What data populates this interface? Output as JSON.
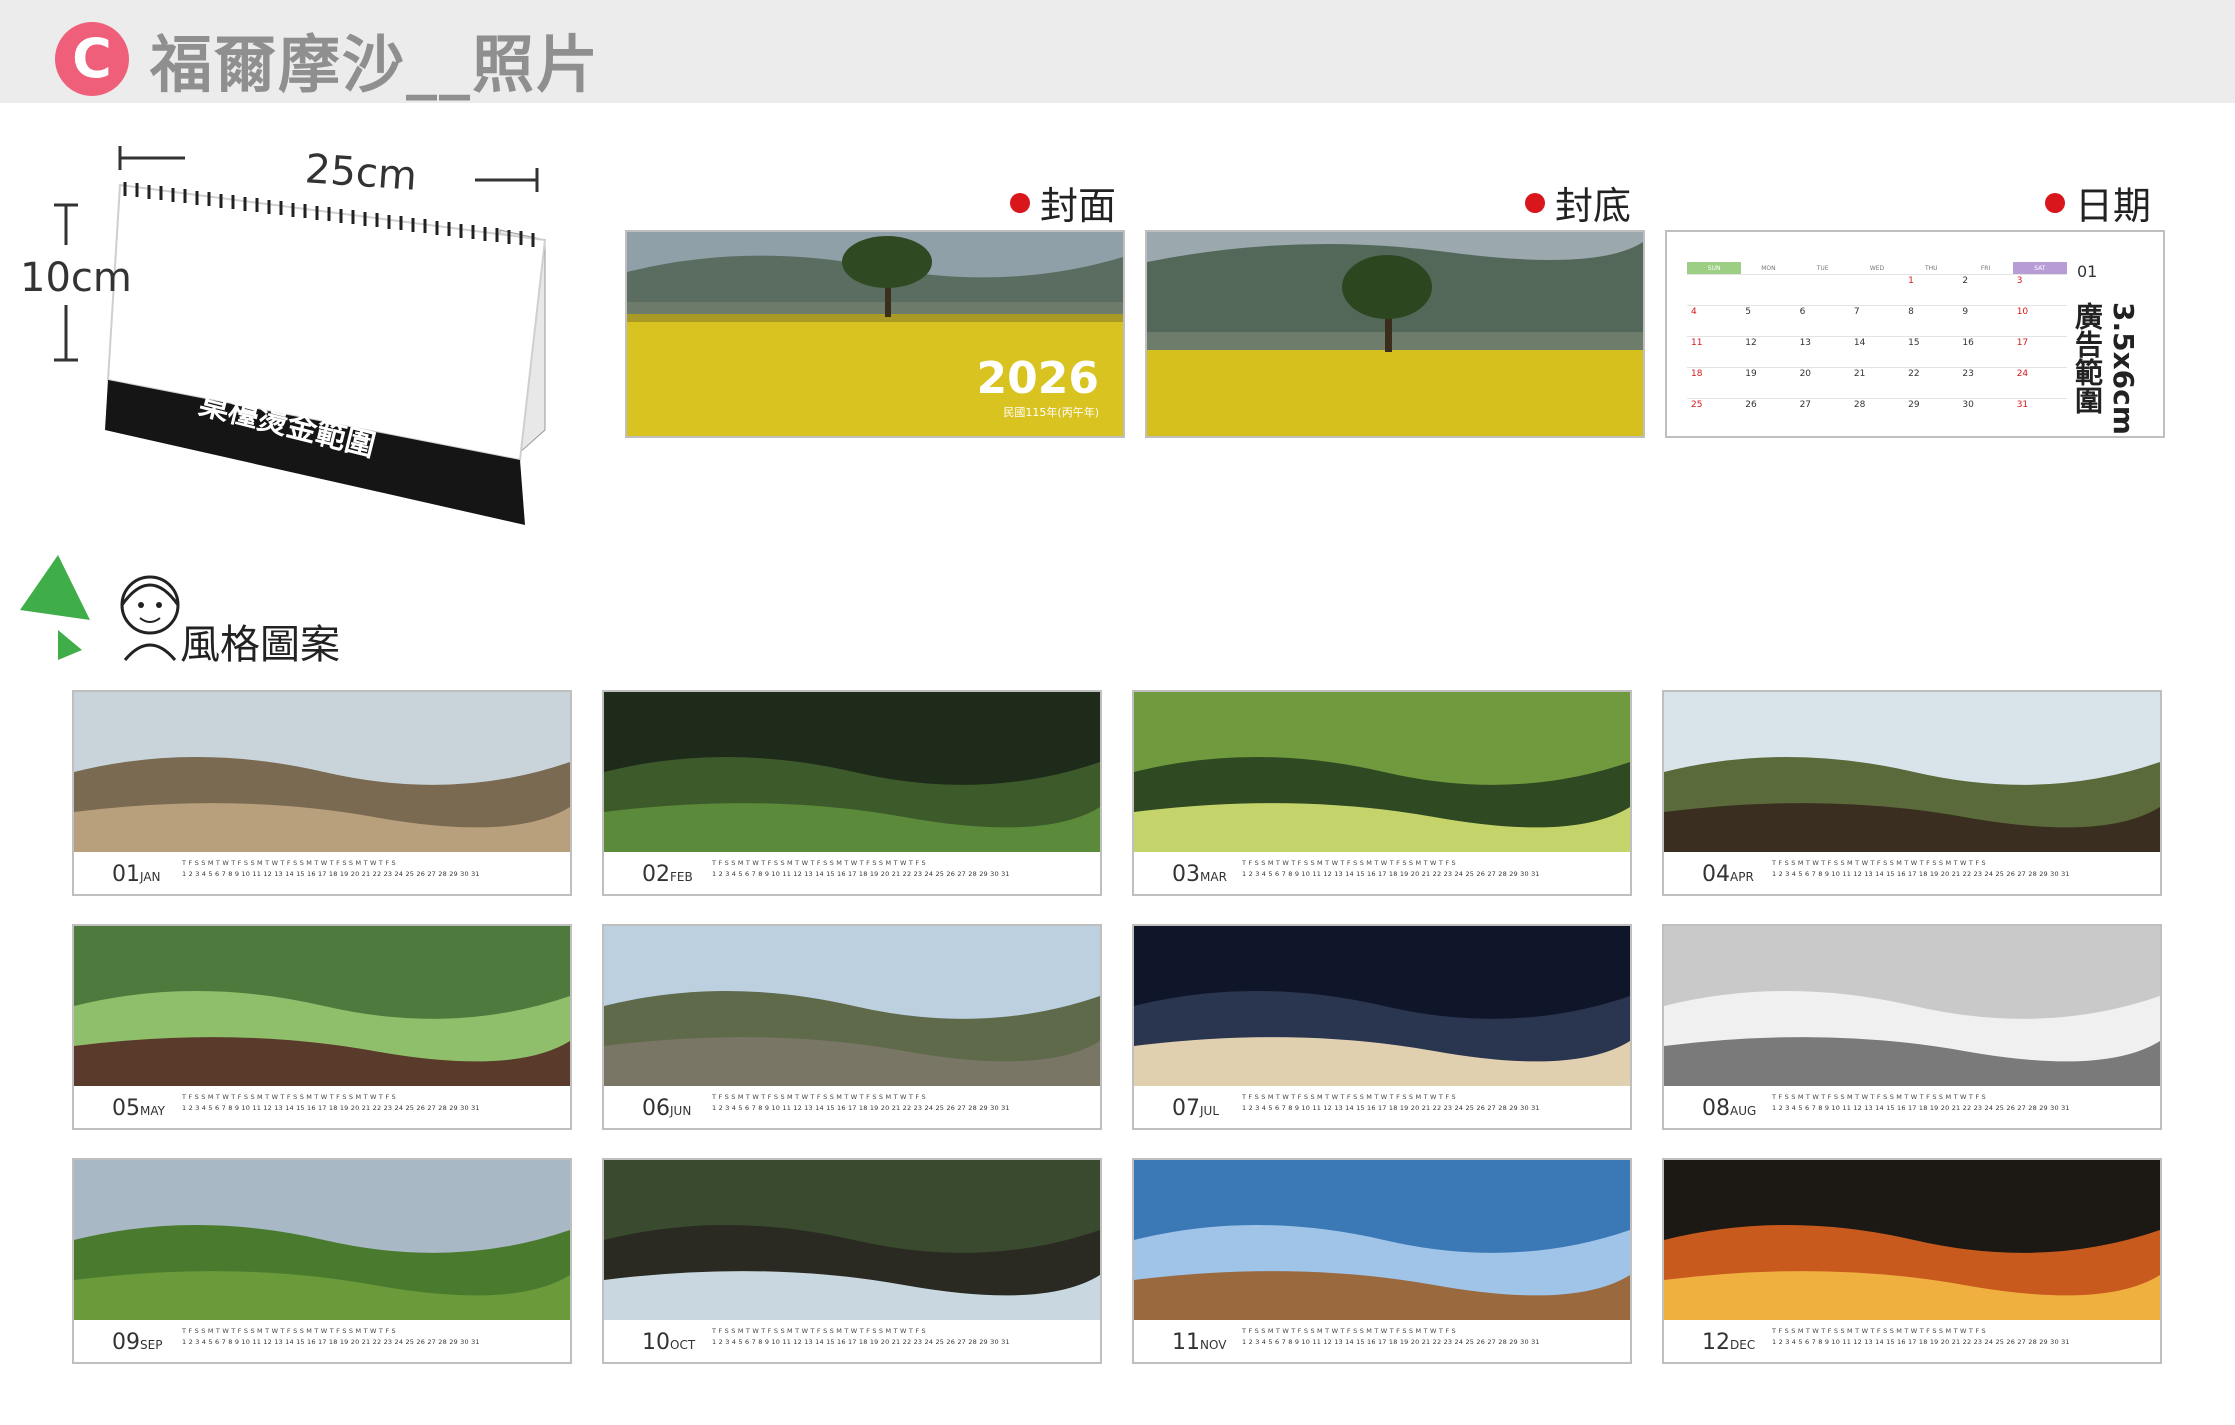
{
  "header": {
    "badge": "C",
    "title": "福爾摩沙__照片"
  },
  "desk": {
    "width_label": "25cm",
    "height_label": "10cm",
    "gold_area_label": "桌檯燙金範圍"
  },
  "sections": {
    "cover": "封面",
    "back": "封底",
    "date": "日期"
  },
  "cover": {
    "year": "2026",
    "subtitle": "民國115年(丙午年)"
  },
  "date_sample": {
    "month_label": "01",
    "weekdays": [
      "SUN",
      "MON",
      "TUE",
      "WED",
      "THU",
      "FRI",
      "SAT"
    ],
    "rows": [
      [
        "",
        "",
        "",
        "",
        "1",
        "2",
        "3"
      ],
      [
        "4",
        "5",
        "6",
        "7",
        "8",
        "9",
        "10"
      ],
      [
        "11",
        "12",
        "13",
        "14",
        "15",
        "16",
        "17"
      ],
      [
        "18",
        "19",
        "20",
        "21",
        "22",
        "23",
        "24"
      ],
      [
        "25",
        "26",
        "27",
        "28",
        "29",
        "30",
        "31"
      ]
    ],
    "ad_text": "3.5x6cm 廣告範圍"
  },
  "style_title": "風格圖案",
  "months": [
    {
      "num": "01",
      "name": "JAN"
    },
    {
      "num": "02",
      "name": "FEB"
    },
    {
      "num": "03",
      "name": "MAR"
    },
    {
      "num": "04",
      "name": "APR"
    },
    {
      "num": "05",
      "name": "MAY"
    },
    {
      "num": "06",
      "name": "JUN"
    },
    {
      "num": "07",
      "name": "JUL"
    },
    {
      "num": "08",
      "name": "AUG"
    },
    {
      "num": "09",
      "name": "SEP"
    },
    {
      "num": "10",
      "name": "OCT"
    },
    {
      "num": "11",
      "name": "NOV"
    },
    {
      "num": "12",
      "name": "DEC"
    }
  ],
  "day_strip": {
    "weekday_letters": "T F S S M T W T F S S M T W T F S S M T W T F S S M T W T F S",
    "numbers": "1 2 3 4 5 6 7 8 9 10 11 12 13 14 15 16 17 18 19 20 21 22 23 24 25 26 27 28 29 30 31"
  },
  "colors": {
    "accent": "#ef5f79",
    "header_bg": "#ececec",
    "dot_red": "#d8161c",
    "border": "#bfbfbf"
  }
}
